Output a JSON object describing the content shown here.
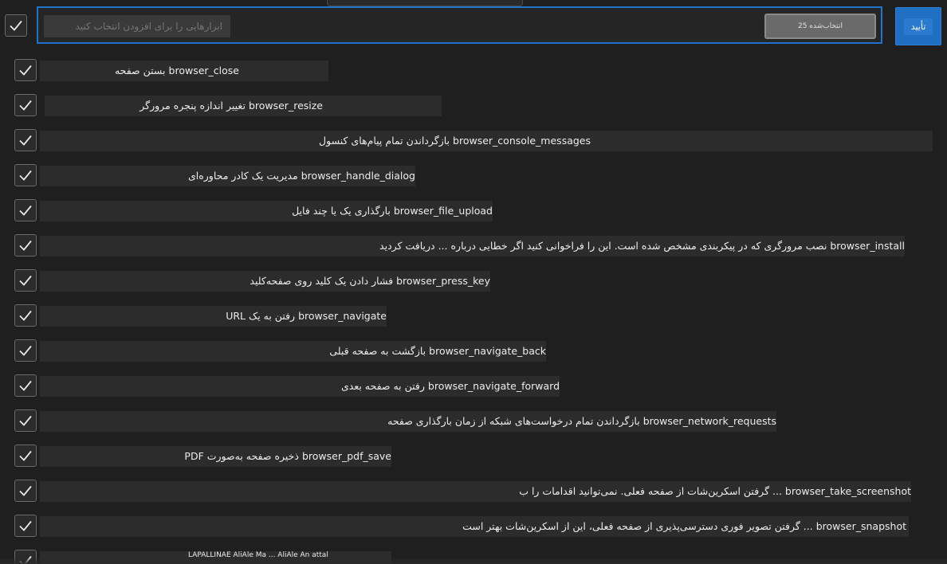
{
  "header": {
    "placeholder": "ابزارهایی را برای افزودن انتخاب کنید",
    "selected_count": "25 انتخاب‌شده",
    "ok_label": "تأیید"
  },
  "tools": [
    {
      "name": "browser_close",
      "desc": "بستن صفحه"
    },
    {
      "name": "browser_resize",
      "desc": "تغییر اندازه پنجره مرورگر"
    },
    {
      "name": "browser_console_messages",
      "desc": "بازگرداندن تمام پیام‌های کنسول"
    },
    {
      "name": "browser_handle_dialog",
      "desc": "مدیریت یک کادر محاوره‌ای"
    },
    {
      "name": "browser_file_upload",
      "desc": "بارگذاری یک یا چند فایل"
    },
    {
      "name": "browser_install",
      "desc": "نصب مرورگری که در پیکربندی مشخص شده است. این را فراخوانی کنید اگر خطایی درباره ... دریافت کردید"
    },
    {
      "name": "browser_press_key",
      "desc": "فشار دادن یک کلید روی صفحه‌کلید"
    },
    {
      "name": "browser_navigate",
      "desc": "رفتن به یک URL"
    },
    {
      "name": "browser_navigate_back",
      "desc": "بازگشت به صفحه قبلی"
    },
    {
      "name": "browser_navigate_forward",
      "desc": "رفتن به صفحه بعدی"
    },
    {
      "name": "browser_network_requests",
      "desc": "بازگرداندن تمام درخواست‌های شبکه از زمان بارگذاری صفحه"
    },
    {
      "name": "browser_pdf_save",
      "desc": "ذخیره صفحه به‌صورت PDF"
    },
    {
      "name": "browser_take_screenshot",
      "desc": "... گرفتن اسکرین‌شات از صفحه فعلی. نمی‌توانید اقدامات را ب"
    },
    {
      "name": "browser_snapshot",
      "desc": "... گرفتن تصویر فوری دسترسی‌پذیری از صفحه فعلی، این از اسکرین‌شات بهتر است"
    }
  ],
  "partial_row_text": "LAPALLINAE AliAle Ma ... AliAle An attal",
  "colors": {
    "background": "#1f1f1f",
    "accent": "#1f74c9",
    "row_bg": "#2c2c2c"
  }
}
